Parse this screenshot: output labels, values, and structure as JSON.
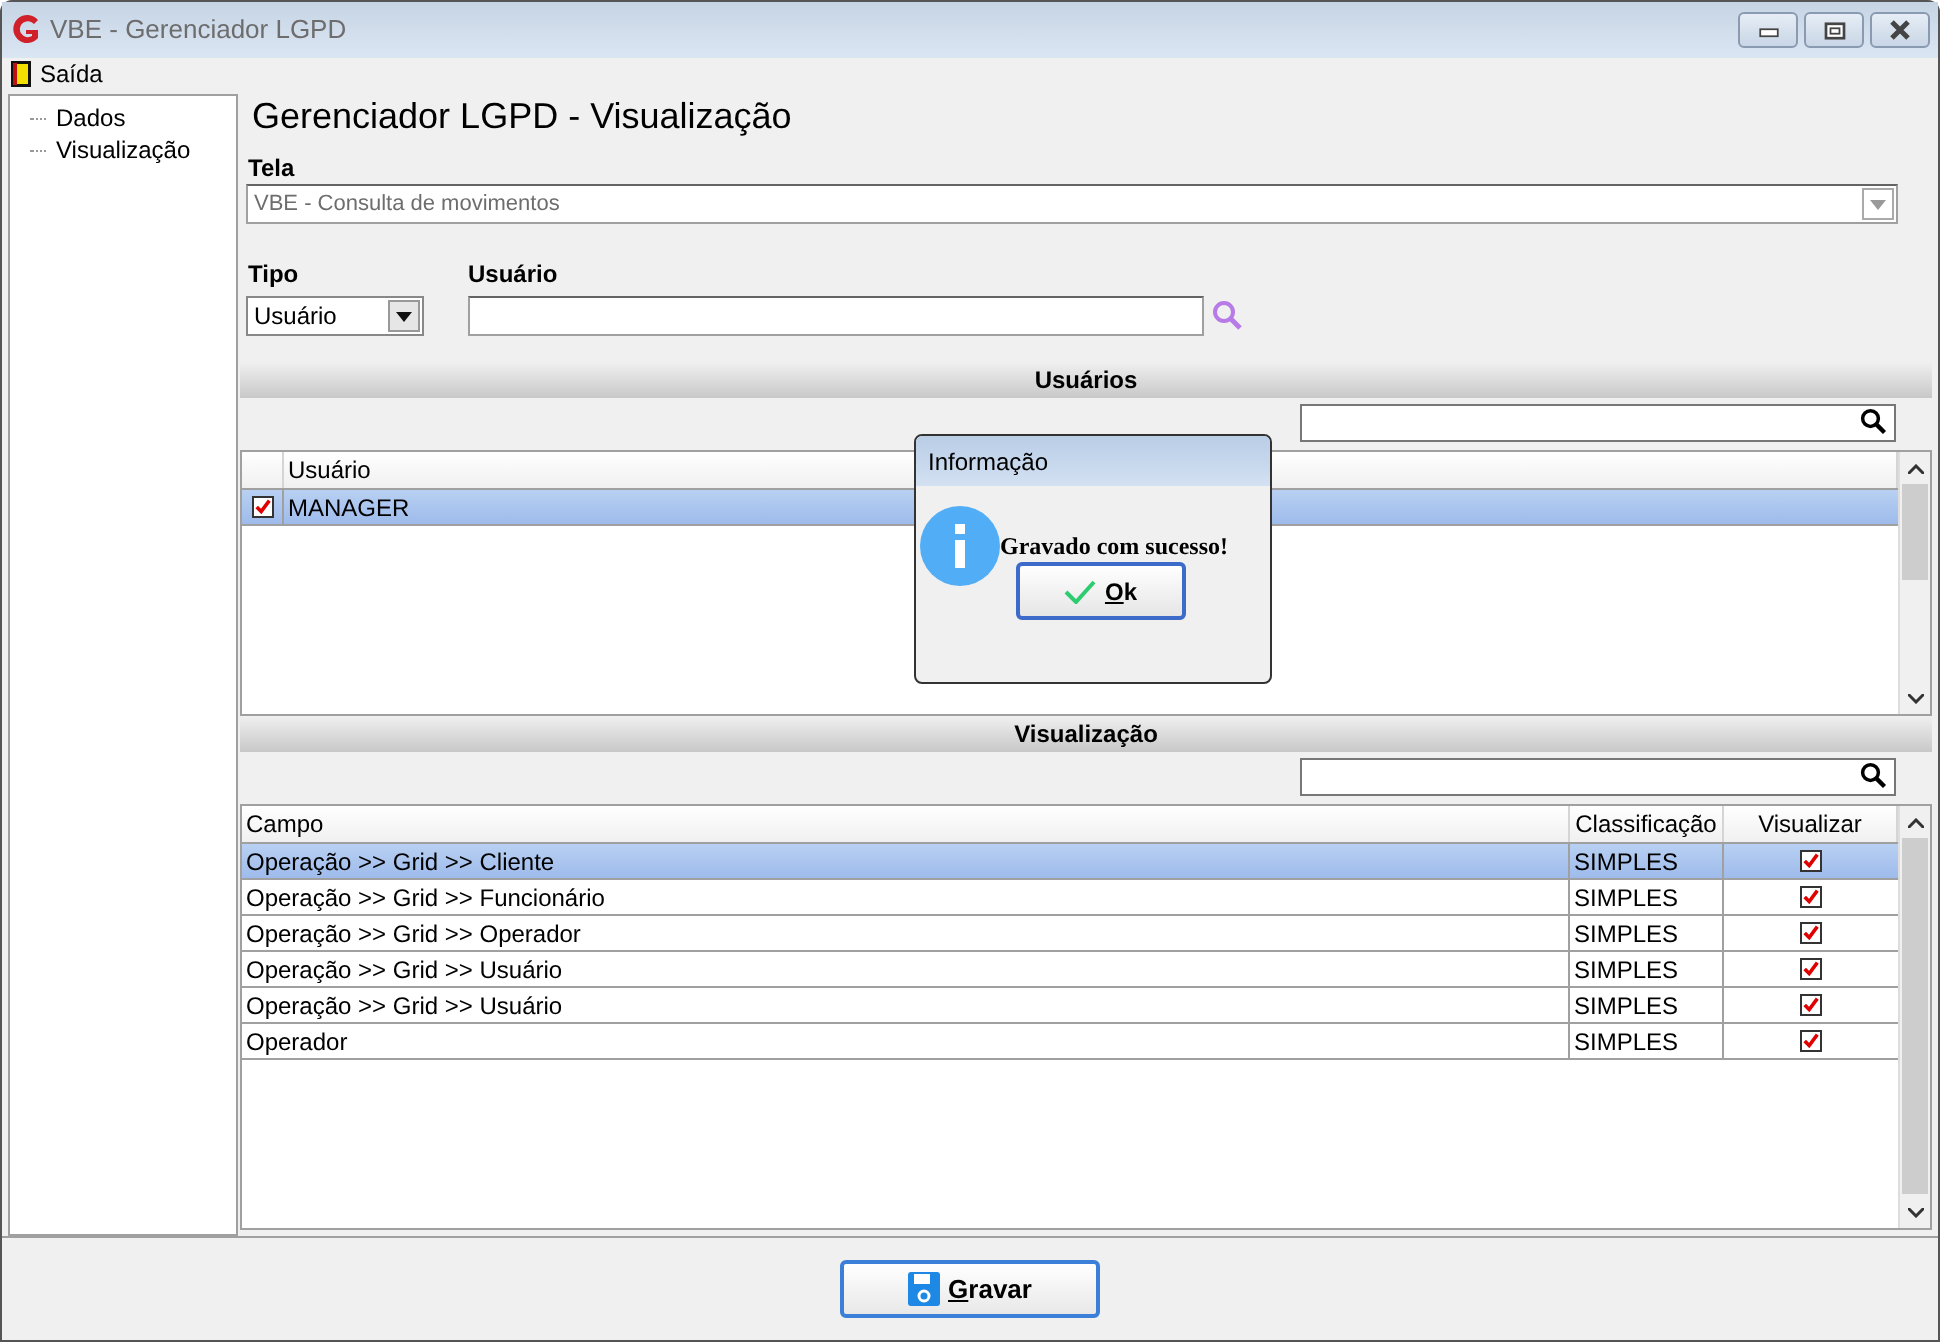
{
  "window": {
    "title": "VBE - Gerenciador LGPD"
  },
  "menu": [
    {
      "label": "Saída"
    }
  ],
  "sidebar": {
    "items": [
      {
        "label": "Dados",
        "selected": false
      },
      {
        "label": "Visualização",
        "selected": false
      }
    ]
  },
  "heading": "Gerenciador LGPD - Visualização",
  "tela": {
    "label": "Tela",
    "value": "VBE - Consulta de movimentos"
  },
  "tipo": {
    "label": "Tipo",
    "value": "Usuário"
  },
  "usuario": {
    "label": "Usuário"
  },
  "users_section": {
    "title": "Usuários",
    "columns": [
      "Usuário"
    ],
    "rows": [
      {
        "name": "MANAGER",
        "checked": true,
        "selected": true
      }
    ]
  },
  "view_section": {
    "title": "Visualização",
    "columns": [
      "Campo",
      "Classificação",
      "Visualizar"
    ],
    "rows": [
      {
        "campo": "Operação >> Grid >> Cliente",
        "classificacao": "SIMPLES",
        "visualizar": true,
        "selected": true
      },
      {
        "campo": "Operação >> Grid >> Funcionário",
        "classificacao": "SIMPLES",
        "visualizar": true,
        "selected": false
      },
      {
        "campo": "Operação >> Grid >> Operador",
        "classificacao": "SIMPLES",
        "visualizar": true,
        "selected": false
      },
      {
        "campo": "Operação >> Grid >> Usuário",
        "classificacao": "SIMPLES",
        "visualizar": true,
        "selected": false
      },
      {
        "campo": "Operação >> Grid >> Usuário",
        "classificacao": "SIMPLES",
        "visualizar": true,
        "selected": false
      },
      {
        "campo": "Operador",
        "classificacao": "SIMPLES",
        "visualizar": true,
        "selected": false
      }
    ]
  },
  "save_button": {
    "label": "Gravar"
  },
  "dialog": {
    "title": "Informação",
    "message": "Gravado com sucesso!",
    "button": "Ok"
  }
}
